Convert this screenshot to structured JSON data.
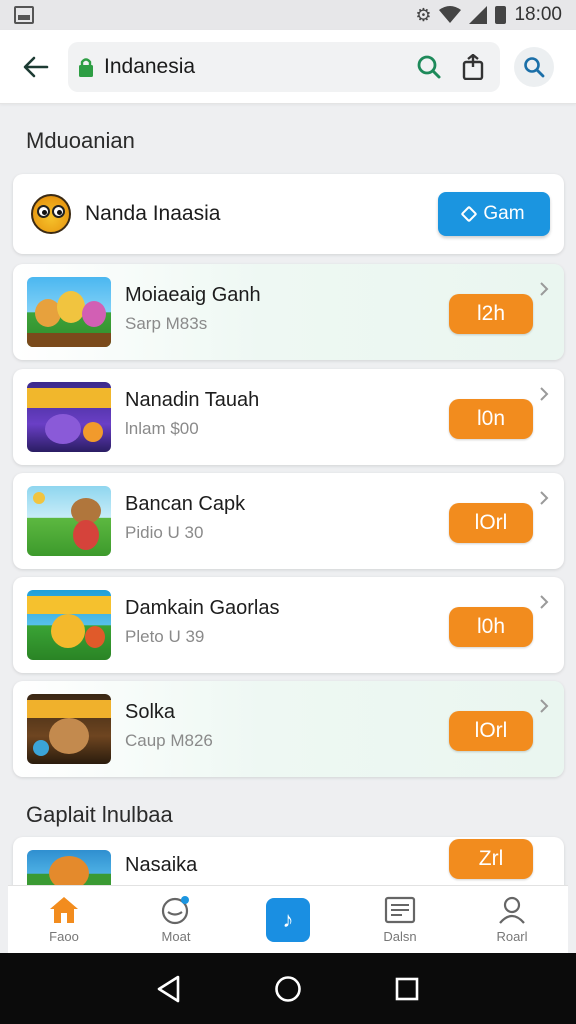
{
  "status_bar": {
    "time": "18:00"
  },
  "app_bar": {
    "url_text": "Indanesia"
  },
  "sections": {
    "main_title": "Mduoanian",
    "second_title": "Gaplait lnulbaa"
  },
  "featured": {
    "name": "Nanda Inaasia",
    "button_label": "Gam"
  },
  "games": [
    {
      "title": "Moiaeaig Ganh",
      "subtitle": "Sarp M83s",
      "price": "l2h"
    },
    {
      "title": "Nanadin Tauah",
      "subtitle": "lnlam $00",
      "price": "l0n"
    },
    {
      "title": "Bancan Capk",
      "subtitle": "Pidio U 30",
      "price": "lOrl"
    },
    {
      "title": "Damkain Gaorlas",
      "subtitle": "Pleto U 39",
      "price": "l0h"
    },
    {
      "title": "Solka",
      "subtitle": "Caup M826",
      "price": "lOrl"
    },
    {
      "title": "Nasaika",
      "subtitle": "",
      "price": "Zrl"
    }
  ],
  "bottom_nav": [
    {
      "label": "Faoo",
      "icon": "home-icon"
    },
    {
      "label": "Moat",
      "icon": "chat-icon"
    },
    {
      "label": "",
      "icon": "app-logo-icon"
    },
    {
      "label": "Dalsn",
      "icon": "news-icon"
    },
    {
      "label": "Roarl",
      "icon": "profile-icon"
    }
  ],
  "colors": {
    "accent_orange": "#f28c1e",
    "accent_blue": "#1b95e0",
    "lock_green": "#2e9e44"
  }
}
